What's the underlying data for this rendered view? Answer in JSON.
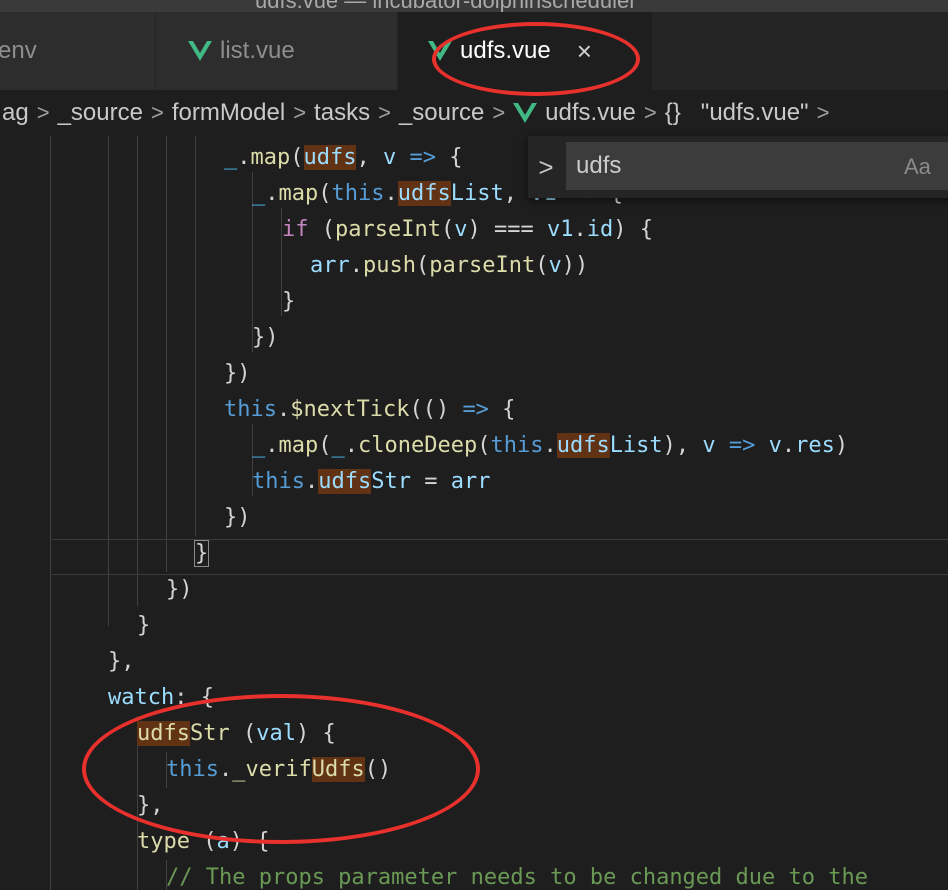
{
  "window": {
    "title": "udfs.vue — incubator-dolphinscheduler"
  },
  "tabs": [
    {
      "label": "env"
    },
    {
      "label": "list.vue"
    },
    {
      "label": "udfs.vue",
      "close": "×"
    }
  ],
  "breadcrumb": {
    "items": [
      "ag",
      "_source",
      "formModel",
      "tasks",
      "_source",
      "udfs.vue",
      "{}",
      "\"udfs.vue\""
    ],
    "separator": ">"
  },
  "find": {
    "toggle": ">",
    "value": "udfs",
    "match_case": "Aa"
  },
  "code": {
    "lines": [
      "_.map(udfs, v => {",
      "_.map(this.udfsList, v1 => {",
      "if (parseInt(v) === v1.id) {",
      "arr.push(parseInt(v))",
      "}",
      "})",
      "})",
      "this.$nextTick(() => {",
      "_.map(_.cloneDeep(this.udfsList), v => v.res)",
      "this.udfsStr = arr",
      "})",
      "}",
      "})",
      "}",
      "},",
      "watch: {",
      "udfsStr (val) {",
      "this._verifUdfs()",
      "},",
      "type (a) {",
      "// The props parameter needs to be changed due to the"
    ]
  },
  "colors": {
    "accent": "#e8312c",
    "vue_green": "#41b883",
    "match_highlight": "#613214"
  }
}
